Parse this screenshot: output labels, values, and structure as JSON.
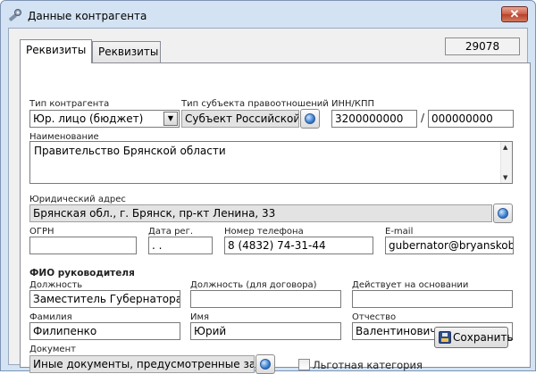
{
  "window": {
    "title": "Данные контрагента",
    "close_label": "✕"
  },
  "tabs": [
    {
      "label": "Реквизиты"
    },
    {
      "label": "Реквизиты"
    }
  ],
  "record_number": "29078",
  "form": {
    "contractor_type": {
      "label": "Тип контрагента",
      "value": "Юр. лицо (бюджет)"
    },
    "subject_type": {
      "label": "Тип субъекта правоотношений",
      "value": "Субъект Российской Ф"
    },
    "inn_kpp": {
      "label": "ИНН/КПП",
      "inn": "3200000000",
      "separator": "/",
      "kpp": "000000000"
    },
    "name": {
      "label": "Наименование",
      "value": "Правительство Брянской области"
    },
    "legal_address": {
      "label": "Юридический адрес",
      "value": "Брянская обл., г. Брянск, пр-кт Ленина, 33"
    },
    "ogrn": {
      "label": "ОГРН",
      "value": ""
    },
    "reg_date": {
      "label": "Дата рег.",
      "value": " .  ."
    },
    "phone": {
      "label": "Номер телефона",
      "value": "8 (4832) 74-31-44"
    },
    "email": {
      "label": "E-mail",
      "value": "gubernator@bryanskobl.r"
    },
    "head_section": "ФИО руководителя",
    "position": {
      "label": "Должность",
      "value": "Заместитель Губернатора Б"
    },
    "position_contract": {
      "label": "Должность (для договора)",
      "value": ""
    },
    "acts_on_basis": {
      "label": "Действует на основании",
      "value": ""
    },
    "last_name": {
      "label": "Фамилия",
      "value": "Филипенко"
    },
    "first_name": {
      "label": "Имя",
      "value": "Юрий"
    },
    "patronymic": {
      "label": "Отчество",
      "value": "Валентинович"
    },
    "document": {
      "label": "Документ",
      "value": "Иные документы, предусмотренные законо"
    },
    "preferential": {
      "label": "Льготная категория",
      "checked": false
    }
  },
  "buttons": {
    "save_label": "Сохранить"
  },
  "icons": {
    "app": "app-wrench-icon",
    "picker": "globe-picker-icon",
    "save": "floppy-disk-icon",
    "combo": "chevron-down-icon"
  },
  "colors": {
    "window_frame": "#d3e3f4",
    "close_button": "#c95c47",
    "readonly_field": "#e3e3e3"
  }
}
